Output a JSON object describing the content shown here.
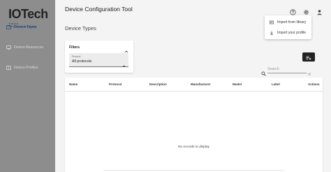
{
  "brand": {
    "name": "IOTech",
    "tagline": "EDGE INTELLIGENCE"
  },
  "sidebar": {
    "items": [
      {
        "label": "Device Types",
        "active": true,
        "icon": "device-types-icon"
      },
      {
        "label": "Device Resources",
        "active": false,
        "icon": "device-resources-icon"
      },
      {
        "label": "Device Profiles",
        "active": false,
        "icon": "device-profiles-icon"
      }
    ]
  },
  "header": {
    "title": "Device Configuration Tool",
    "icons": [
      "help-icon",
      "settings-icon",
      "account-icon"
    ]
  },
  "menu": {
    "items": [
      {
        "label": "Import from library",
        "icon": "library-icon"
      },
      {
        "label": "Import your profile",
        "icon": "download-icon"
      }
    ]
  },
  "page": {
    "section_title": "Device Types"
  },
  "filters": {
    "title": "Filters",
    "protocol": {
      "label": "Protocol",
      "value": "All protocols"
    }
  },
  "search": {
    "placeholder": "Search"
  },
  "table": {
    "columns": [
      "Name",
      "Protocol",
      "Description",
      "Manufacturer",
      "Model",
      "Label",
      "Actions"
    ],
    "rows": [],
    "empty_message": "No records to display"
  },
  "colors": {
    "sidebar_bg": "#8d8d8d",
    "active_nav": "#2c4f87",
    "add_button": "#222222",
    "page_bg": "#f4f4f4"
  }
}
